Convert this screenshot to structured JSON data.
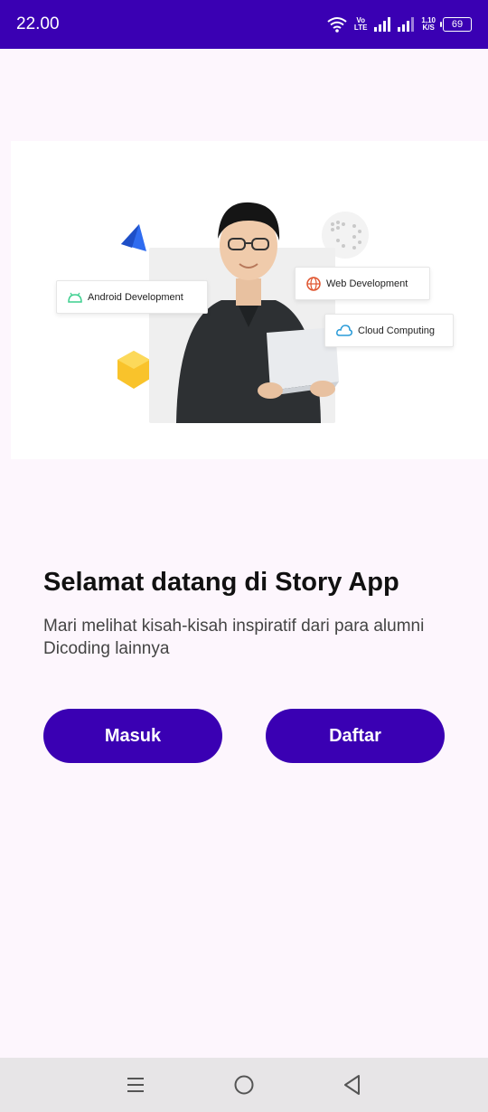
{
  "status_bar": {
    "time": "22.00",
    "network_top": "Vo",
    "network_bottom": "LTE",
    "speed_value": "1,10",
    "speed_unit": "K/S",
    "battery_level": "69"
  },
  "hero": {
    "tags": {
      "android": "Android Development",
      "web": "Web Development",
      "cloud": "Cloud Computing"
    }
  },
  "welcome": {
    "title": "Selamat datang di Story App",
    "subtitle": "Mari melihat kisah-kisah inspiratif dari para alumni Dicoding lainnya"
  },
  "actions": {
    "login_label": "Masuk",
    "register_label": "Daftar"
  },
  "colors": {
    "primary": "#3a00b3",
    "background": "#fdf6fd",
    "nav_bar": "#e7e5e7"
  }
}
